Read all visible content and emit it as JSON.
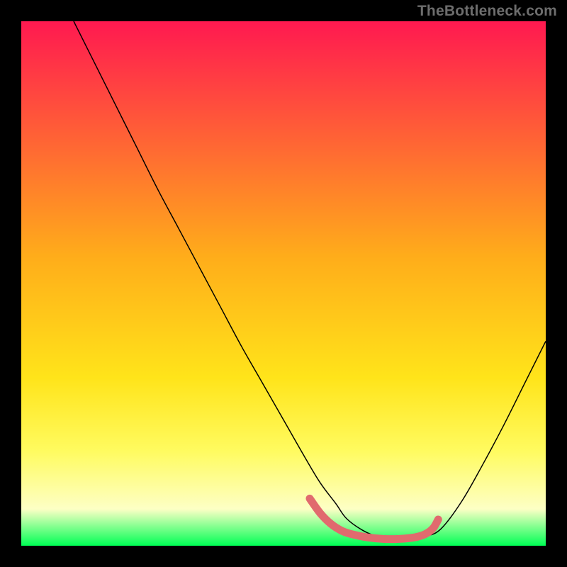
{
  "watermark_text": "TheBottleneck.com",
  "chart_data": {
    "type": "line",
    "title": "",
    "xlabel": "",
    "ylabel": "",
    "xlim": [
      0,
      100
    ],
    "ylim": [
      0,
      100
    ],
    "grid": false,
    "legend": false,
    "background_gradient": {
      "stops": [
        {
          "offset": 0.0,
          "color": "#ff1950"
        },
        {
          "offset": 0.45,
          "color": "#ffad1a"
        },
        {
          "offset": 0.68,
          "color": "#ffe41a"
        },
        {
          "offset": 0.82,
          "color": "#fffb60"
        },
        {
          "offset": 0.93,
          "color": "#fdffc5"
        },
        {
          "offset": 1.0,
          "color": "#00ff55"
        }
      ]
    },
    "series": [
      {
        "name": "bottleneck-curve",
        "color": "#000000",
        "width": 1.5,
        "x": [
          10,
          14,
          18,
          22,
          26,
          30,
          34,
          38,
          42,
          46,
          50,
          54,
          57,
          60,
          62,
          65,
          68,
          71,
          74,
          77,
          80,
          84,
          88,
          92,
          96,
          100
        ],
        "y": [
          100,
          92,
          84,
          76,
          68,
          60.5,
          53,
          45.5,
          38,
          31,
          24,
          17,
          12,
          8,
          5.2,
          3.0,
          1.7,
          1.2,
          1.2,
          1.8,
          3.2,
          8.5,
          15.5,
          23,
          31,
          39
        ]
      },
      {
        "name": "optimal-band-marker",
        "color": "#e16a6e",
        "width": 11,
        "linecap": "round",
        "x": [
          55,
          57,
          59,
          61,
          63,
          66,
          69,
          72,
          75,
          77,
          78.5,
          79.5
        ],
        "y": [
          9.0,
          6.2,
          4.2,
          2.9,
          2.2,
          1.6,
          1.3,
          1.3,
          1.6,
          2.2,
          3.3,
          5.0
        ]
      }
    ]
  }
}
